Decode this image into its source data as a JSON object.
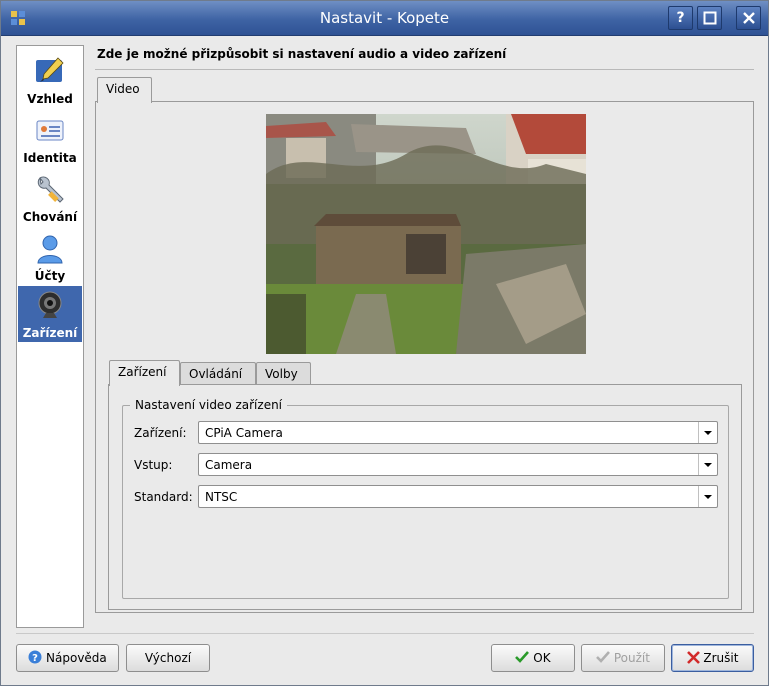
{
  "window": {
    "title": "Nastavit - Kopete"
  },
  "titlebar_buttons": {
    "help": "?",
    "maximize": "□",
    "close": "✕"
  },
  "sidebar": {
    "items": [
      {
        "label": "Vzhled",
        "icon": "paintbrush-icon"
      },
      {
        "label": "Identita",
        "icon": "id-card-icon"
      },
      {
        "label": "Chování",
        "icon": "wrench-icon"
      },
      {
        "label": "Účty",
        "icon": "user-icon"
      },
      {
        "label": "Zařízení",
        "icon": "webcam-icon",
        "active": true
      }
    ]
  },
  "header": {
    "text": "Zde je možné přizpůsobit si nastavení audio a video zařízení"
  },
  "main_tabs": [
    {
      "label": "Video"
    }
  ],
  "sub_tabs": [
    {
      "label": "Zařízení"
    },
    {
      "label": "Ovládání"
    },
    {
      "label": "Volby"
    }
  ],
  "device_group": {
    "title": "Nastavení video zařízení",
    "fields": [
      {
        "label": "Zařízení:",
        "value": "CPiA Camera"
      },
      {
        "label": "Vstup:",
        "value": "Camera"
      },
      {
        "label": "Standard:",
        "value": "NTSC"
      }
    ]
  },
  "buttons": {
    "help": "Nápověda",
    "defaults": "Výchozí",
    "ok": "OK",
    "apply": "Použít",
    "cancel": "Zrušit"
  },
  "colors": {
    "titlebar": "#3e63a4",
    "selection": "#3f67ad",
    "ok_check": "#2a9a2a",
    "cancel_x": "#d22a2a"
  }
}
